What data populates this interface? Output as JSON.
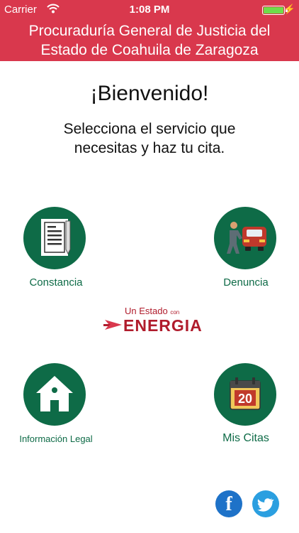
{
  "status_bar": {
    "carrier": "Carrier",
    "time": "1:08 PM"
  },
  "header": {
    "title_line1": "Procuraduría General de Justicia del",
    "title_line2": "Estado de Coahuila de Zaragoza"
  },
  "welcome": "¡Bienvenido!",
  "subtitle_line1": "Selecciona el servicio que",
  "subtitle_line2": "necesitas y haz tu cita.",
  "services": {
    "constancia": "Constancia",
    "denuncia": "Denuncia",
    "informacion_legal": "Información Legal",
    "mis_citas": "Mis Citas"
  },
  "calendar_day": "20",
  "logo": {
    "top": "Un Estado",
    "con": "con",
    "brand": "ENERGIA"
  },
  "social": {
    "facebook_letter": "f"
  },
  "colors": {
    "header": "#d9384d",
    "primary": "#0e6b47",
    "facebook": "#1e72c8",
    "twitter": "#2b9fe0"
  },
  "icons": [
    "wifi-icon",
    "battery-icon",
    "document-icon",
    "police-car-icon",
    "house-icon",
    "calendar-icon",
    "facebook-icon",
    "twitter-icon"
  ]
}
